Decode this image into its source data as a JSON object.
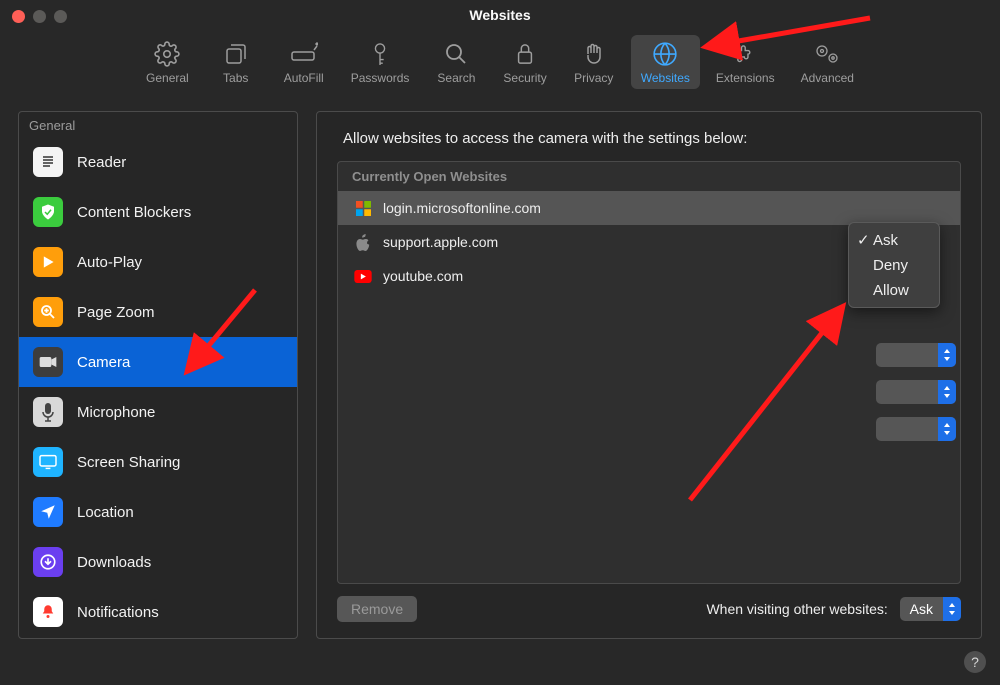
{
  "window_title": "Websites",
  "toolbar": [
    {
      "id": "general",
      "label": "General"
    },
    {
      "id": "tabs",
      "label": "Tabs"
    },
    {
      "id": "autofill",
      "label": "AutoFill"
    },
    {
      "id": "passwords",
      "label": "Passwords"
    },
    {
      "id": "search",
      "label": "Search"
    },
    {
      "id": "security",
      "label": "Security"
    },
    {
      "id": "privacy",
      "label": "Privacy"
    },
    {
      "id": "websites",
      "label": "Websites",
      "active": true
    },
    {
      "id": "extensions",
      "label": "Extensions"
    },
    {
      "id": "advanced",
      "label": "Advanced"
    }
  ],
  "sidebar": {
    "header": "General",
    "items": [
      {
        "id": "reader",
        "label": "Reader"
      },
      {
        "id": "content-blockers",
        "label": "Content Blockers"
      },
      {
        "id": "auto-play",
        "label": "Auto-Play"
      },
      {
        "id": "page-zoom",
        "label": "Page Zoom"
      },
      {
        "id": "camera",
        "label": "Camera",
        "selected": true
      },
      {
        "id": "microphone",
        "label": "Microphone"
      },
      {
        "id": "screen-sharing",
        "label": "Screen Sharing"
      },
      {
        "id": "location",
        "label": "Location"
      },
      {
        "id": "downloads",
        "label": "Downloads"
      },
      {
        "id": "notifications",
        "label": "Notifications"
      }
    ]
  },
  "panel": {
    "heading": "Allow websites to access the camera with the settings below:",
    "section_header": "Currently Open Websites",
    "sites": [
      {
        "id": "ms",
        "label": "login.microsoftonline.com",
        "selected": true
      },
      {
        "id": "apple",
        "label": "support.apple.com"
      },
      {
        "id": "yt",
        "label": "youtube.com"
      }
    ],
    "remove_label": "Remove",
    "visiting_label": "When visiting other websites:",
    "visiting_value": "Ask"
  },
  "popup": {
    "options": [
      {
        "label": "Ask",
        "checked": true
      },
      {
        "label": "Deny"
      },
      {
        "label": "Allow"
      }
    ]
  },
  "help_label": "?"
}
